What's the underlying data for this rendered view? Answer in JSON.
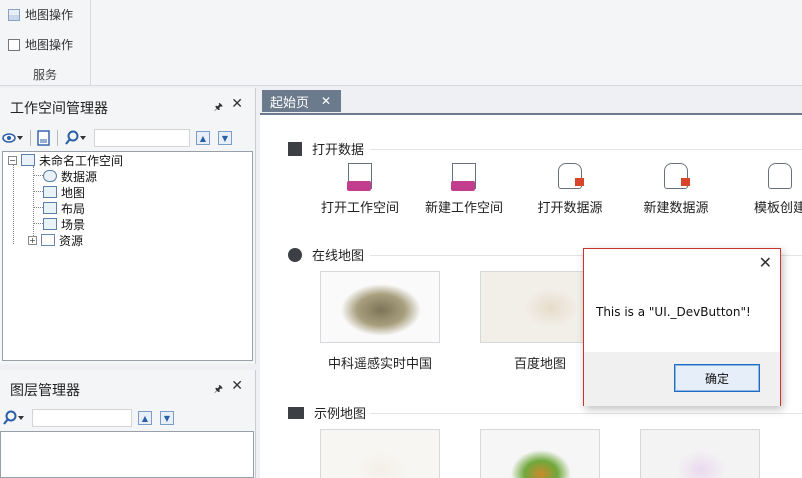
{
  "ribbon": {
    "item1_label": "地图操作",
    "item2_label": "地图操作",
    "group_label": "服务"
  },
  "workspace_panel": {
    "title": "工作空间管理器",
    "pin_glyph": "🖈",
    "close_glyph": "✕",
    "tree": {
      "root": "未命名工作空间",
      "children": [
        "数据源",
        "地图",
        "布局",
        "场景",
        "资源"
      ]
    }
  },
  "layer_panel": {
    "title": "图层管理器",
    "pin_glyph": "🖈",
    "close_glyph": "✕"
  },
  "main": {
    "tab_label": "起始页",
    "tab_close": "✕",
    "sections": {
      "open_data": {
        "title": "打开数据",
        "items": [
          "打开工作空间",
          "新建工作空间",
          "打开数据源",
          "新建数据源",
          "模板创建"
        ]
      },
      "online_maps": {
        "title": "在线地图",
        "items": [
          "中科遥感实时中国",
          "百度地图"
        ]
      },
      "sample_maps": {
        "title": "示例地图"
      }
    }
  },
  "dialog": {
    "message": "This is a \"UI._DevButton\"!",
    "ok_label": "确定",
    "close_glyph": "✕"
  }
}
